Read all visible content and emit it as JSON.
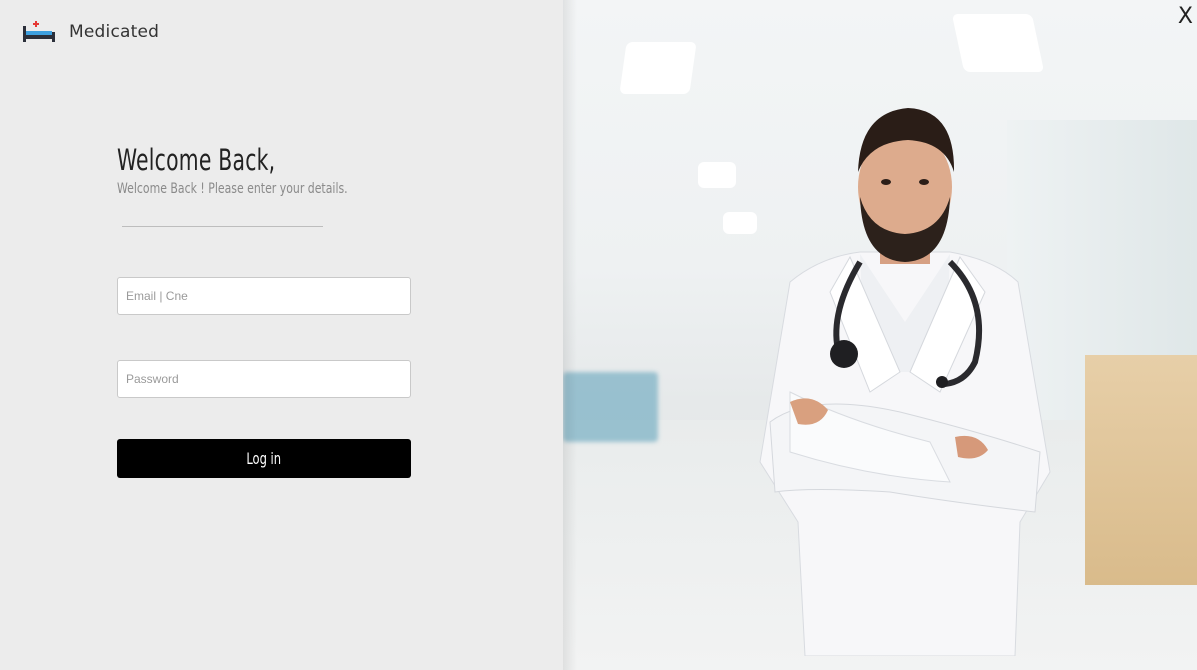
{
  "brand": {
    "name": "Medicated",
    "icon": "hospital-bed-icon"
  },
  "login": {
    "title": "Welcome Back,",
    "subtitle": "Welcome Back ! Please enter your details.",
    "email_placeholder": "Email | Cne",
    "password_placeholder": "Password",
    "submit_label": "Log in"
  },
  "window": {
    "close_label": "X"
  },
  "colors": {
    "panel_bg": "#ececec",
    "button_bg": "#000000",
    "button_text": "#ffffff"
  }
}
